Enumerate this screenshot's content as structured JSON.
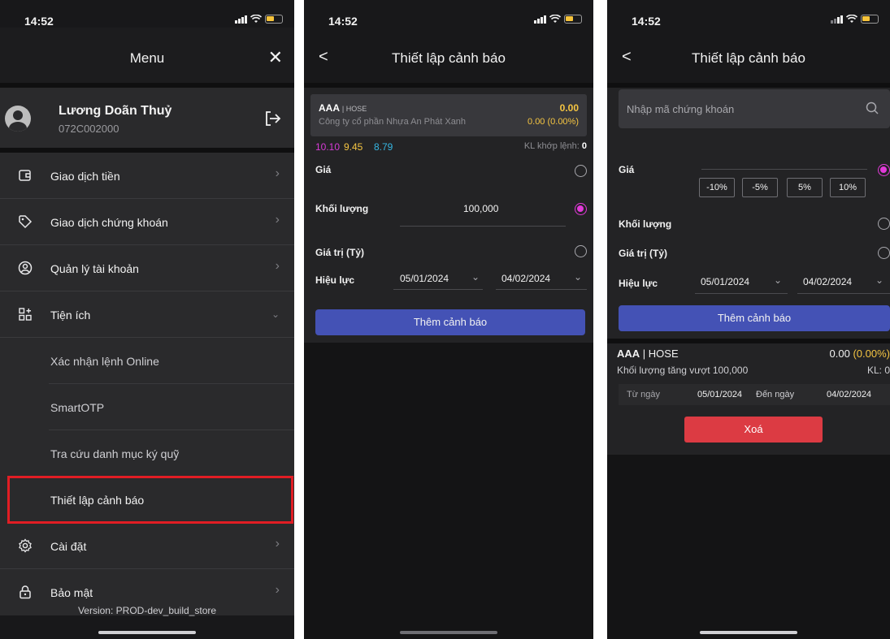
{
  "status_time": "14:52",
  "menu_panel": {
    "title": "Menu",
    "close_glyph": "✕",
    "user_name": "Lương Doãn Thuỷ",
    "user_id": "072C002000",
    "items": [
      {
        "label": "Giao dịch tiền",
        "icon": "wallet-icon"
      },
      {
        "label": "Giao dịch chứng khoán",
        "icon": "tag-icon"
      },
      {
        "label": "Quản lý tài khoản",
        "icon": "user-circle-icon"
      },
      {
        "label": "Tiện ích",
        "icon": "grid-plus-icon"
      }
    ],
    "sub_items": [
      {
        "label": "Xác nhận lệnh Online"
      },
      {
        "label": "SmartOTP"
      },
      {
        "label": "Tra cứu danh mục ký quỹ"
      },
      {
        "label": "Thiết lập cảnh báo"
      }
    ],
    "bottom_items": [
      {
        "label": "Cài đặt",
        "icon": "gear-icon"
      },
      {
        "label": "Bảo mật",
        "icon": "lock-icon"
      }
    ],
    "version": "Version: PROD-dev_build_store",
    "highlight_color": "#e11d24"
  },
  "alert_panel": {
    "title": "Thiết lập cảnh báo",
    "back_glyph": "<",
    "symbol": "AAA",
    "exchange": "| HOSE",
    "company": "Công ty cổ phần Nhựa An Phát Xanh",
    "price": "0.00",
    "change": "0.00 (0.00%)",
    "ceiling": "10.10",
    "reference": "9.45",
    "floor": "8.79",
    "kl_label": "KL khớp lệnh:",
    "kl_value": "0",
    "label_price": "Giá",
    "label_volume": "Khối lượng",
    "volume_value": "100,000",
    "label_value": "Giá trị (Tỷ)",
    "label_validity": "Hiệu lực",
    "date_from": "05/01/2024",
    "date_to": "04/02/2024",
    "add_button": "Thêm cảnh báo",
    "accent": "#4452b5"
  },
  "alert_panel_2": {
    "title": "Thiết lập cảnh báo",
    "back_glyph": "<",
    "search_placeholder": "Nhập mã chứng khoán",
    "label_price": "Giá",
    "pct_buttons": [
      "-10%",
      "-5%",
      "5%",
      "10%"
    ],
    "label_volume": "Khối lượng",
    "label_value": "Giá trị (Tỷ)",
    "label_validity": "Hiệu lực",
    "date_from": "05/01/2024",
    "date_to": "04/02/2024",
    "add_button": "Thêm cảnh báo",
    "alert": {
      "symbol": "AAA",
      "exchange": "| HOSE",
      "price": "0.00",
      "change": "(0.00%)",
      "condition": "Khối lượng tăng vượt 100,000",
      "kl": "KL: 0",
      "from_label": "Từ ngày",
      "from_date": "05/01/2024",
      "to_label": "Đến ngày",
      "to_date": "04/02/2024"
    },
    "delete_button": "Xoá"
  }
}
